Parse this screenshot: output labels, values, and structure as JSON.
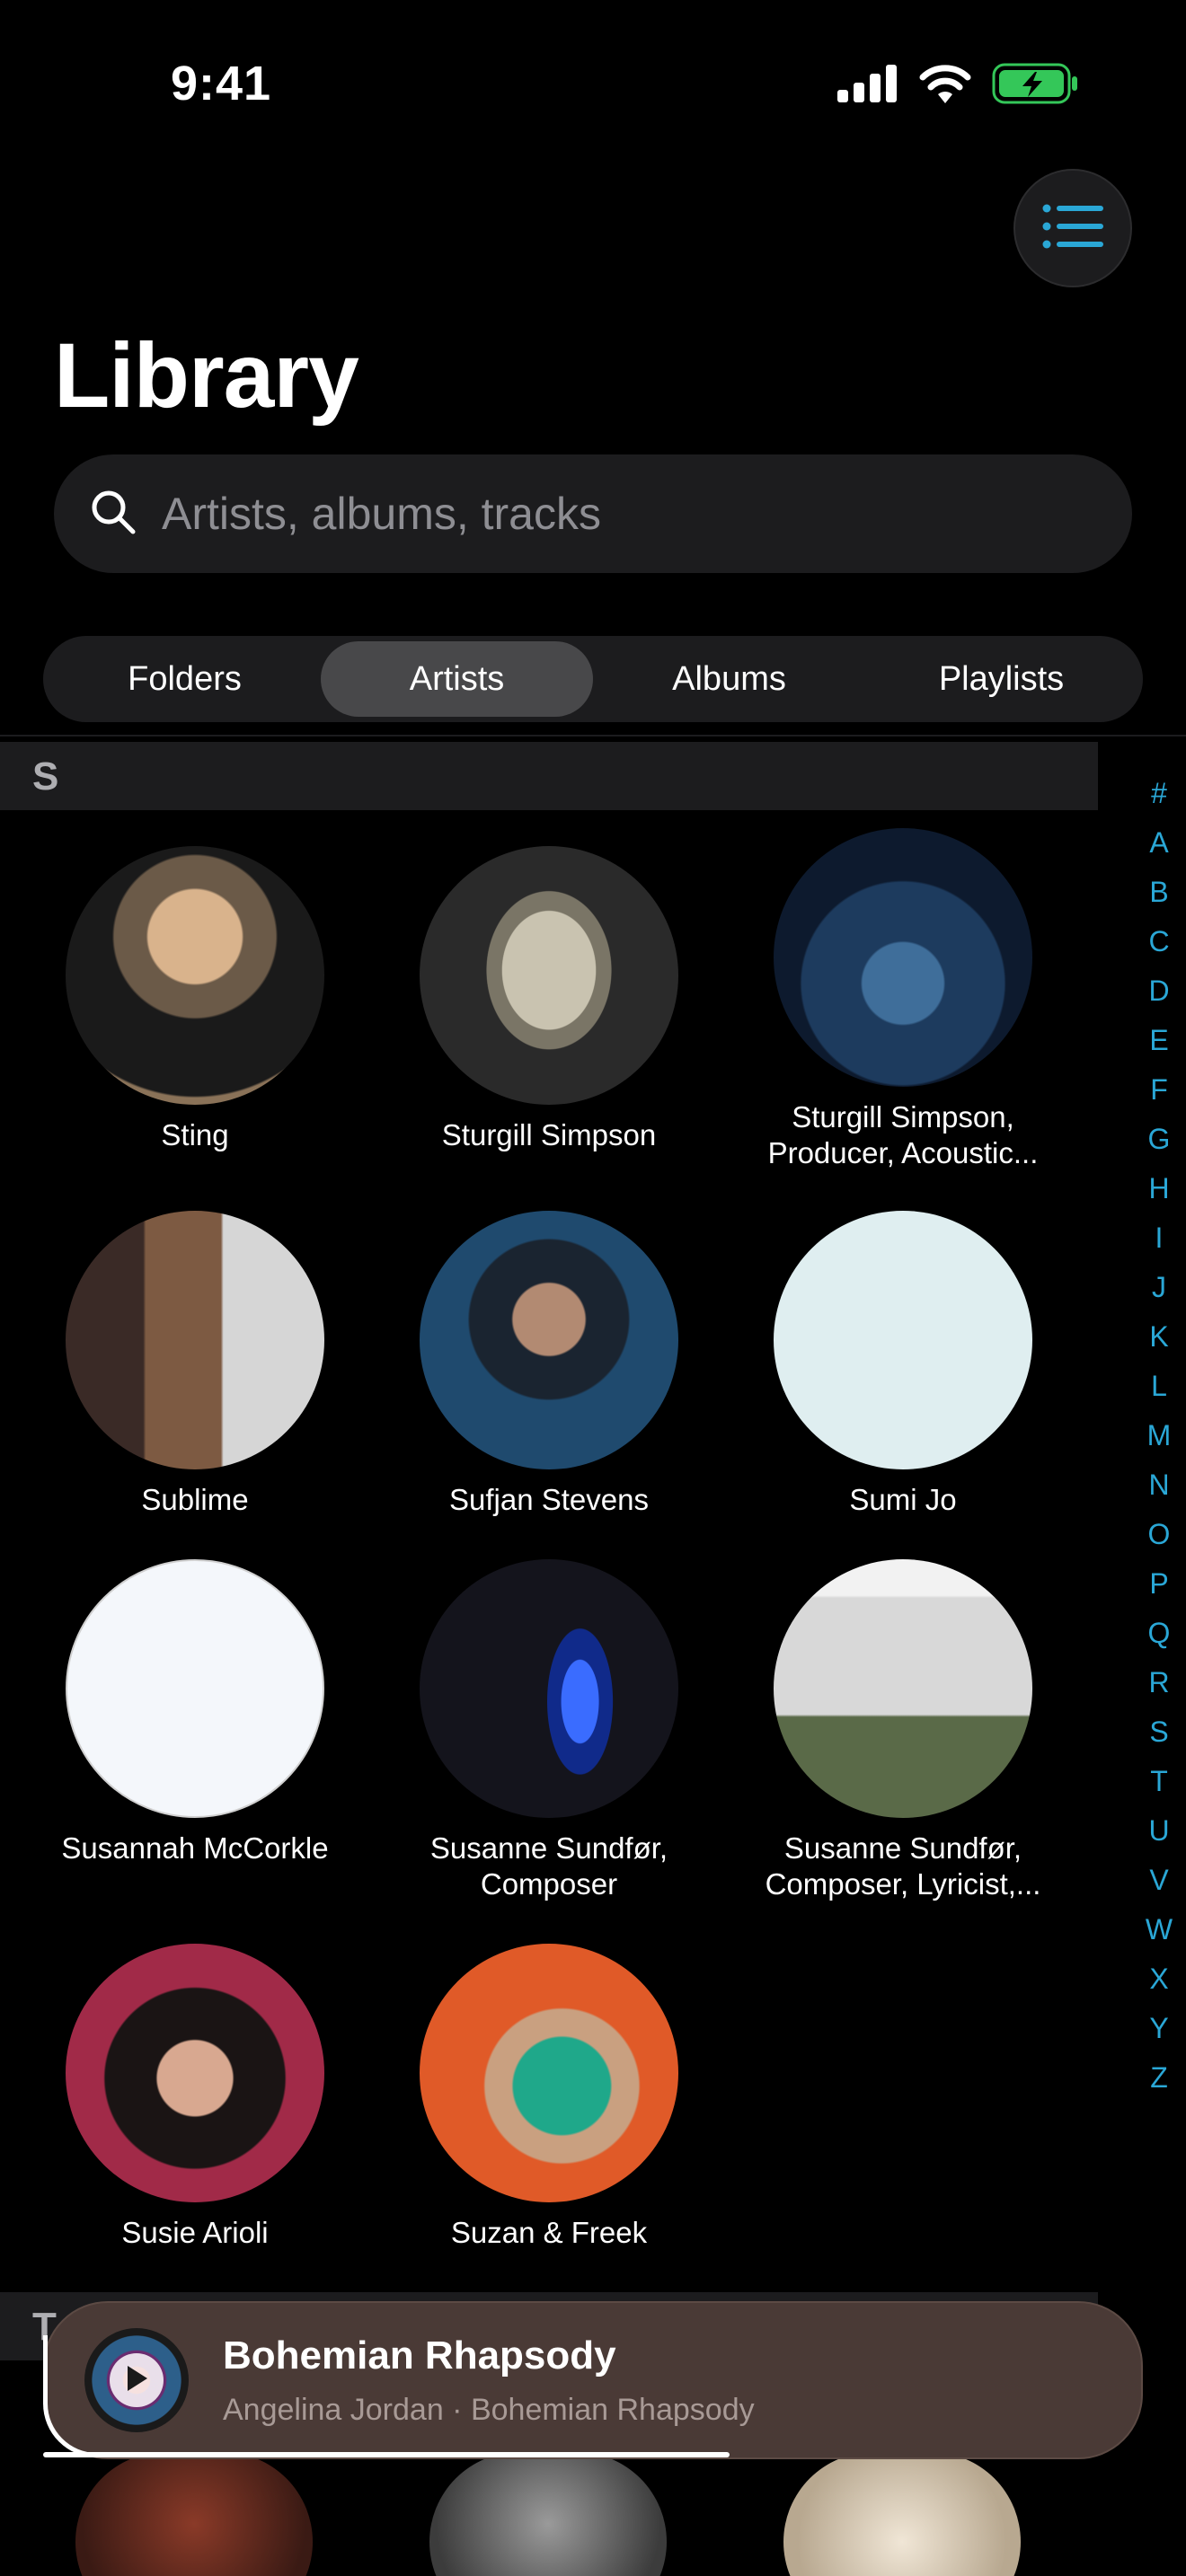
{
  "status": {
    "time": "9:41"
  },
  "page": {
    "title": "Library"
  },
  "search": {
    "placeholder": "Artists, albums, tracks"
  },
  "tabs": [
    {
      "label": "Folders",
      "active": false
    },
    {
      "label": "Artists",
      "active": true
    },
    {
      "label": "Albums",
      "active": false
    },
    {
      "label": "Playlists",
      "active": false
    }
  ],
  "sections": {
    "s": "S",
    "t": "T"
  },
  "alphabet": [
    "#",
    "A",
    "B",
    "C",
    "D",
    "E",
    "F",
    "G",
    "H",
    "I",
    "J",
    "K",
    "L",
    "M",
    "N",
    "O",
    "P",
    "Q",
    "R",
    "S",
    "T",
    "U",
    "V",
    "W",
    "X",
    "Y",
    "Z"
  ],
  "artists": [
    {
      "name": "Sting"
    },
    {
      "name": "Sturgill Simpson"
    },
    {
      "name": "Sturgill Simpson,\nProducer, Acoustic..."
    },
    {
      "name": "Sublime"
    },
    {
      "name": "Sufjan Stevens"
    },
    {
      "name": "Sumi Jo"
    },
    {
      "name": "Susannah McCorkle"
    },
    {
      "name": "Susanne Sundfør,\nComposer"
    },
    {
      "name": "Susanne Sundfør,\nComposer, Lyricist,..."
    },
    {
      "name": "Susie Arioli"
    },
    {
      "name": "Suzan & Freek"
    }
  ],
  "now_playing": {
    "title": "Bohemian Rhapsody",
    "subtitle": "Angelina Jordan · Bohemian Rhapsody",
    "progress": 0.52
  },
  "colors": {
    "accent": "#2aa7d6",
    "battery": "#34c759",
    "now_playing_bg": "#4a3a36"
  }
}
